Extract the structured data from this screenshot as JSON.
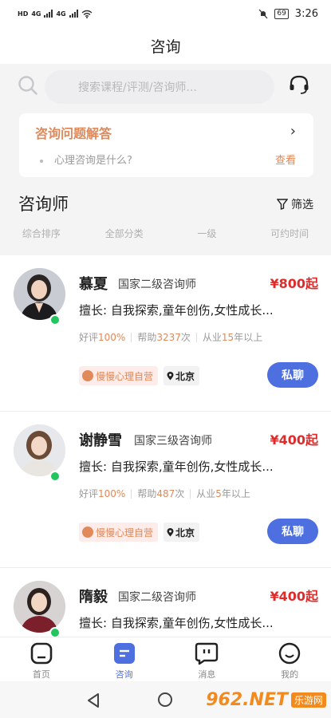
{
  "status_bar": {
    "left_labels": [
      "HD",
      "4G",
      "4G"
    ],
    "battery": "69",
    "time": "3:26"
  },
  "header": {
    "title": "咨询"
  },
  "search": {
    "placeholder": "搜索课程/评测/咨询师..."
  },
  "faq": {
    "title": "咨询问题解答",
    "chevron": "›",
    "item": "心理咨询是什么?",
    "link": "查看"
  },
  "section": {
    "title": "咨询师",
    "filter_label": "筛选"
  },
  "sort_options": [
    "综合排序",
    "全部分类",
    "一级",
    "可约时间"
  ],
  "counselors": [
    {
      "name": "慕夏",
      "level": "国家二级咨询师",
      "price": "¥800起",
      "specialty": "擅长: 自我探索,童年创伤,女性成长...",
      "stat_rating_label": "好评",
      "stat_rating_value": "100%",
      "stat_help_label": "帮助",
      "stat_help_value": "3237",
      "stat_help_unit": "次",
      "stat_exp_label": "从业",
      "stat_exp_value": "15",
      "stat_exp_unit": "年以上",
      "tag": "慢慢心理自营",
      "city": "北京",
      "chat": "私聊"
    },
    {
      "name": "谢静雪",
      "level": "国家三级咨询师",
      "price": "¥400起",
      "specialty": "擅长: 自我探索,童年创伤,女性成长...",
      "stat_rating_label": "好评",
      "stat_rating_value": "100%",
      "stat_help_label": "帮助",
      "stat_help_value": "487",
      "stat_help_unit": "次",
      "stat_exp_label": "从业",
      "stat_exp_value": "5",
      "stat_exp_unit": "年以上",
      "tag": "慢慢心理自营",
      "city": "北京",
      "chat": "私聊"
    },
    {
      "name": "隋毅",
      "level": "国家二级咨询师",
      "price": "¥400起",
      "specialty": "擅长: 自我探索,童年创伤,女性成长..."
    }
  ],
  "tabs": [
    {
      "label": "首页",
      "icon": "home-icon",
      "active": false
    },
    {
      "label": "咨询",
      "icon": "consult-icon",
      "active": true
    },
    {
      "label": "消息",
      "icon": "message-icon",
      "active": false
    },
    {
      "label": "我的",
      "icon": "profile-icon",
      "active": false
    }
  ],
  "watermark": {
    "logo": "962.NET",
    "sub": "乐游网"
  },
  "colors": {
    "accent": "#4d6fe0",
    "price": "#e02b2b",
    "highlight": "#e0895a",
    "online": "#22c55e"
  }
}
